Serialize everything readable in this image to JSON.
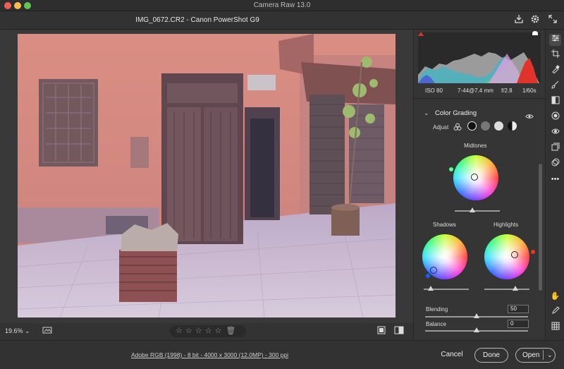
{
  "window": {
    "title": "Camera Raw 13.0"
  },
  "header": {
    "filename": "IMG_0672.CR2  -  Canon PowerShot G9"
  },
  "exif": {
    "iso": "ISO 80",
    "focal": "7-44@7.4 mm",
    "aperture": "f/2.8",
    "shutter": "1/60s"
  },
  "color_grading": {
    "title": "Color Grading",
    "adjust_label": "Adjust",
    "midtones_label": "Midtones",
    "shadows_label": "Shadows",
    "highlights_label": "Highlights",
    "blending_label": "Blending",
    "blending_value": "50",
    "balance_label": "Balance",
    "balance_value": "0"
  },
  "bottombar": {
    "zoom": "19.6%",
    "stars": "☆☆☆☆☆"
  },
  "footer": {
    "workflow_link": "Adobe RGB (1998) - 8 bit - 4000 x 3000 (12.0MP) - 300 ppi",
    "cancel": "Cancel",
    "done": "Done",
    "open": "Open"
  },
  "colors": {
    "accent": "#ffffff",
    "red_clip": "#e0332c",
    "wheel_dot_shadows": "#1f5cff",
    "wheel_dot_highlights": "#e8391f"
  }
}
